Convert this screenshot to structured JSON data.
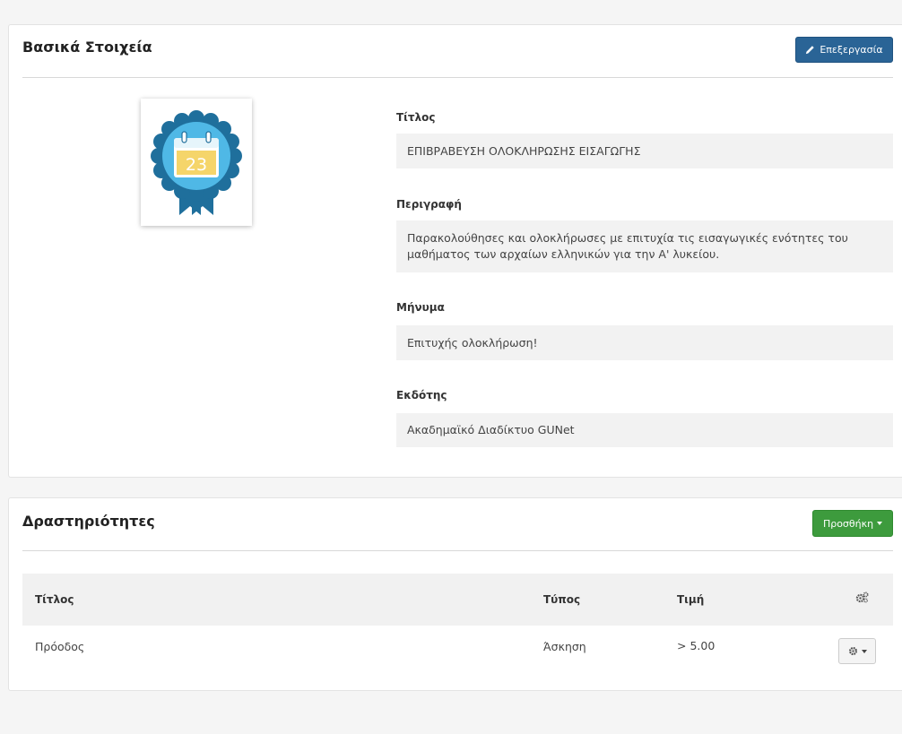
{
  "basic_panel": {
    "title": "Βασικά Στοιχεία",
    "edit_button_label": "Επεξεργασία",
    "badge": {
      "icon": "calendar-badge-icon",
      "number": "23",
      "colors": {
        "seal": "#1f6f9c",
        "inner": "#4fb8e6",
        "page": "#f5d56a",
        "ribbon": "#1f6f9c"
      }
    },
    "fields": [
      {
        "label": "Τίτλος",
        "value": "ΕΠΙΒΡΑΒΕΥΣΗ ΟΛΟΚΛΗΡΩΣΗΣ ΕΙΣΑΓΩΓΗΣ"
      },
      {
        "label": "Περιγραφή",
        "value": "Παρακολούθησες και ολοκλήρωσες με επιτυχία τις εισαγωγικές ενότητες του μαθήματος των αρχαίων ελληνικών για την Α' λυκείου."
      },
      {
        "label": "Μήνυμα",
        "value": "Επιτυχής ολοκλήρωση!"
      },
      {
        "label": "Εκδότης",
        "value": "Ακαδημαϊκό Διαδίκτυο GUNet"
      }
    ]
  },
  "activities_panel": {
    "title": "Δραστηριότητες",
    "add_button_label": "Προσθήκη",
    "table": {
      "headers": {
        "title": "Τίτλος",
        "type": "Τύπος",
        "value": "Τιμή",
        "actions_icon": "gears-icon"
      },
      "rows": [
        {
          "title": "Πρόοδος",
          "type": "Άσκηση",
          "value": "> 5.00",
          "actions_icon": "gear-icon"
        }
      ]
    }
  },
  "colors": {
    "edit_button": "#2a6496",
    "add_button": "#3d9b3d",
    "field_bg": "#f2f2f2",
    "table_head_bg": "#f1f1f1"
  }
}
